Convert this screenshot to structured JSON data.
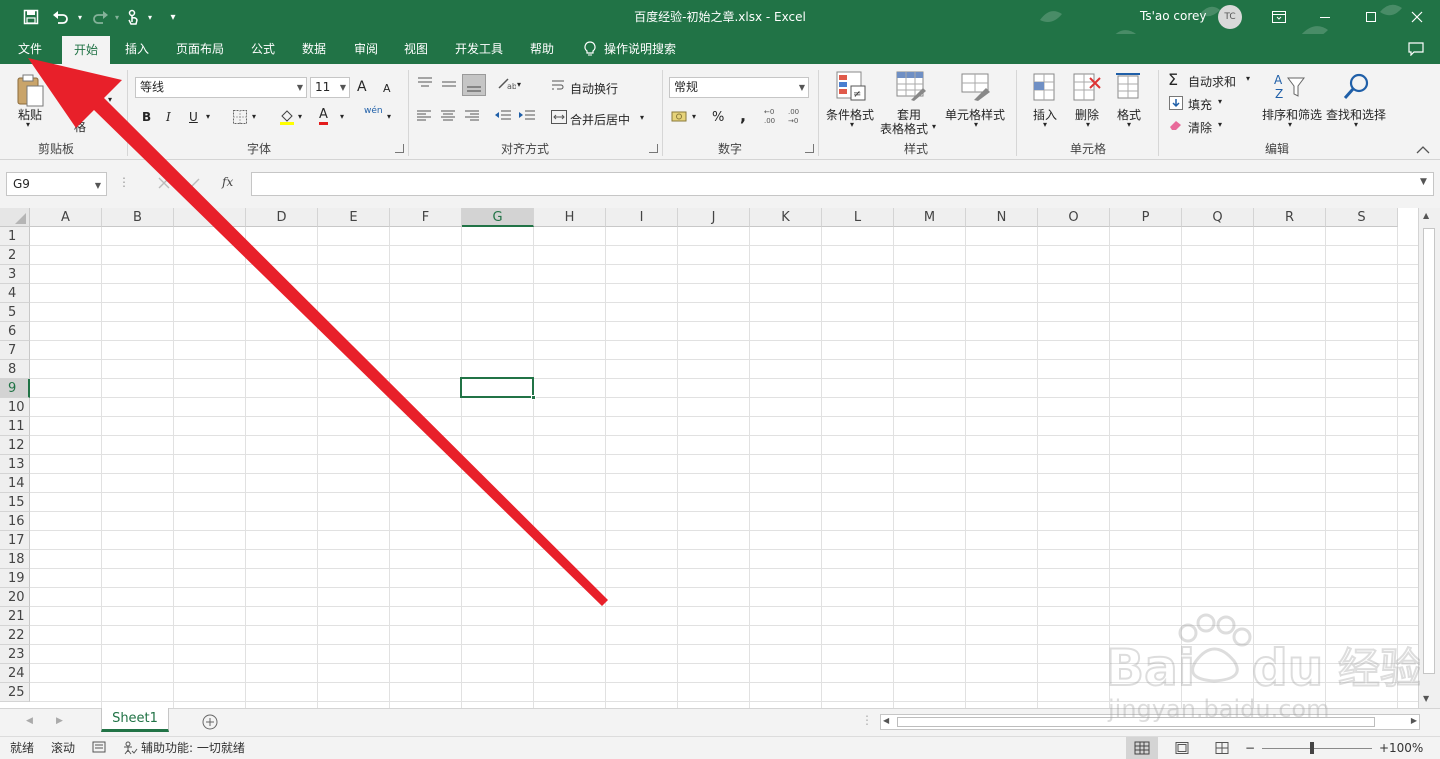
{
  "window": {
    "title": "百度经验-初始之章.xlsx  -  Excel",
    "user_name": "Ts'ao corey",
    "user_initials": "TC"
  },
  "qat": {
    "save": "save-icon",
    "undo": "undo-icon",
    "redo": "redo-icon",
    "touch": "touch-mode-icon",
    "customize": "customize-qat-icon"
  },
  "tabs": [
    "文件",
    "开始",
    "插入",
    "页面布局",
    "公式",
    "数据",
    "审阅",
    "视图",
    "开发工具",
    "帮助"
  ],
  "active_tab": "开始",
  "tell_me": "操作说明搜索",
  "clipboard": {
    "paste": "粘贴",
    "cut_partial": "剪切",
    "format_painter_partial": "格",
    "label": "剪贴板"
  },
  "font": {
    "name": "等线",
    "size": "11",
    "bold": "B",
    "italic": "I",
    "underline": "U",
    "grow": "A",
    "shrink": "A",
    "font_color": "A",
    "phonetic": "wén",
    "label": "字体"
  },
  "alignment": {
    "wrap_text": "自动换行",
    "merge_center": "合并后居中",
    "label": "对齐方式"
  },
  "number": {
    "format": "常规",
    "percent": "%",
    "comma": ",",
    "inc_dec": ".00",
    "label": "数字"
  },
  "styles": {
    "conditional": "条件格式",
    "table_line1": "套用",
    "table_line2": "表格格式",
    "cell_styles": "单元格样式",
    "label": "样式"
  },
  "cells": {
    "insert": "插入",
    "delete": "删除",
    "format": "格式",
    "label": "单元格"
  },
  "editing": {
    "autosum": "自动求和",
    "fill": "填充",
    "clear": "清除",
    "sort_filter": "排序和筛选",
    "find_select": "查找和选择",
    "label": "编辑"
  },
  "formula_bar": {
    "name_box": "G9",
    "fx": "fx",
    "formula": ""
  },
  "columns": [
    "A",
    "B",
    "C",
    "D",
    "E",
    "F",
    "G",
    "H",
    "I",
    "J",
    "K",
    "L",
    "M",
    "N",
    "O",
    "P",
    "Q",
    "R",
    "S"
  ],
  "rows": [
    "1",
    "2",
    "3",
    "4",
    "5",
    "6",
    "7",
    "8",
    "9",
    "10",
    "11",
    "12",
    "13",
    "14",
    "15",
    "16",
    "17",
    "18",
    "19",
    "20",
    "21",
    "22",
    "23",
    "24",
    "25"
  ],
  "selected_cell": {
    "col": "G",
    "row": "9"
  },
  "sheet_tabs": [
    "Sheet1"
  ],
  "status": {
    "ready": "就绪",
    "scroll": "滚动",
    "accessibility": "辅助功能: 一切就绪",
    "zoom": "100%"
  },
  "watermark": {
    "brand_text": "Bai",
    "brand_text2": "du",
    "brand_cn": "经验",
    "url": "jingyan.baidu.com"
  },
  "colors": {
    "excel_green": "#217346",
    "arrow_red": "#e8202a"
  }
}
